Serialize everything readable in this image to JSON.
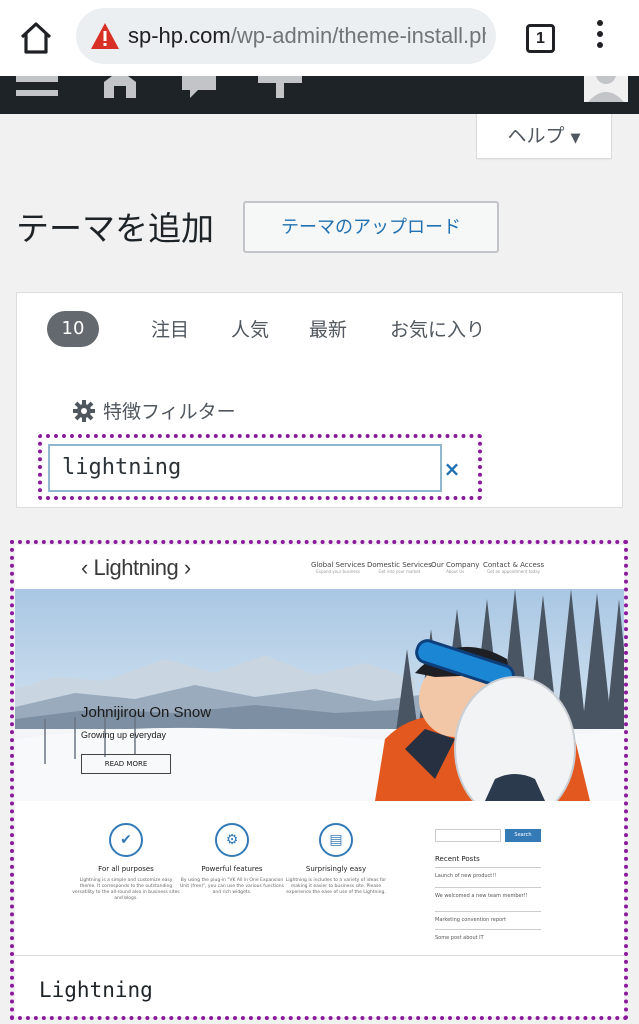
{
  "browser": {
    "url_host": "sp-hp.com",
    "url_path": "/wp-admin/theme-install.ph",
    "tab_count": "1",
    "icons": [
      "home-icon",
      "warning-icon",
      "tab-switcher-icon",
      "more-vert-icon"
    ]
  },
  "admin_bar": {
    "icons": [
      "menu-icon",
      "home-icon",
      "comments-icon",
      "add-new-icon",
      "avatar"
    ],
    "color": "#1d2327"
  },
  "help": {
    "label": "ヘルプ",
    "arrow": "▼"
  },
  "page": {
    "title": "テーマを追加",
    "upload_button": "テーマのアップロード"
  },
  "filter": {
    "count": "10",
    "tabs": [
      "注目",
      "人気",
      "最新",
      "お気に入り"
    ],
    "feature_filter": "特徴フィルター",
    "search_value": "lightning",
    "clear": "×"
  },
  "theme_card": {
    "name": "Lightning",
    "preview": {
      "logo": "‹ Lightning ›",
      "nav": [
        {
          "label": "Global Services",
          "sub": "Expand your business"
        },
        {
          "label": "Domestic Services",
          "sub": "Get into your market"
        },
        {
          "label": "Our Company",
          "sub": "About Us"
        },
        {
          "label": "Contact & Access",
          "sub": "Get an appointment today"
        }
      ],
      "hero_title": "Johnijirou On Snow",
      "hero_subtitle": "Growing up everyday",
      "hero_button": "READ MORE",
      "features": [
        {
          "title": "For all purposes",
          "icon": "✔",
          "desc": "Lightning is a simple and customize easy theme. It corresponds to the outstanding versatility to the all-round also in business sites and blogs."
        },
        {
          "title": "Powerful features",
          "icon": "⚙",
          "desc": "By using the plug-in \"VK All in One Expansion Unit (free)\", you can use the various functions and rich widgets."
        },
        {
          "title": "Surprisingly easy",
          "icon": "▤",
          "desc": "Lightning is includes to a variety of ideas for making it easier to business site. Please experience the ease of use of the Lightning."
        }
      ],
      "sidebar": {
        "search_button": "Search",
        "recent_title": "Recent Posts",
        "posts": [
          "Launch of new product!!",
          "We welcomed a new team member!!",
          "Marketing convention report",
          "Some post about IT"
        ]
      }
    }
  },
  "highlight_color": "#8b1a9c"
}
